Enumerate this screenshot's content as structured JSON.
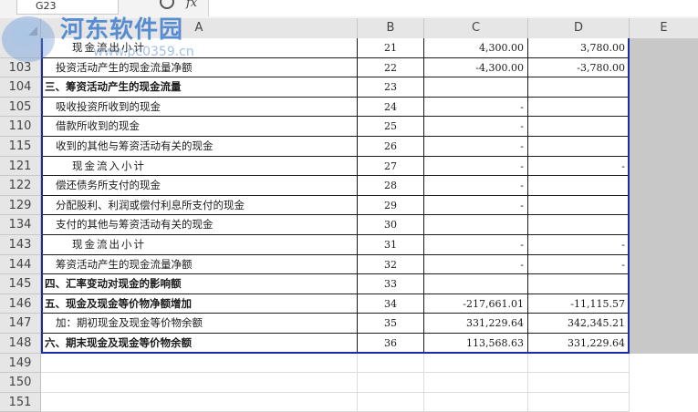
{
  "toolbar": {
    "name_box": "G23",
    "fx_label": "fx"
  },
  "watermark": {
    "title": "河东软件园",
    "url": "www.pc0359.cn"
  },
  "columns": [
    "A",
    "B",
    "C",
    "D",
    "E"
  ],
  "rows": [
    {
      "num": "",
      "a": "现金流出小计",
      "b": "21",
      "c": "4,300.00",
      "d": "3,780.00",
      "style": "ind2"
    },
    {
      "num": "103",
      "a": "投资活动产生的现金流量净额",
      "b": "22",
      "c": "-4,300.00",
      "d": "-3,780.00",
      "style": "ind1"
    },
    {
      "num": "104",
      "a": "三、筹资活动产生的现金流量",
      "b": "23",
      "c": "",
      "d": "",
      "style": "bold"
    },
    {
      "num": "105",
      "a": "吸收投资所收到的现金",
      "b": "24",
      "c": "-",
      "d": "",
      "style": "ind1"
    },
    {
      "num": "110",
      "a": "借款所收到的现金",
      "b": "25",
      "c": "-",
      "d": "",
      "style": "ind1"
    },
    {
      "num": "115",
      "a": "收到的其他与筹资活动有关的现金",
      "b": "26",
      "c": "-",
      "d": "",
      "style": "ind1"
    },
    {
      "num": "121",
      "a": "现金流入小计",
      "b": "27",
      "c": "-",
      "d": "-",
      "style": "ind2"
    },
    {
      "num": "122",
      "a": "偿还债务所支付的现金",
      "b": "28",
      "c": "-",
      "d": "",
      "style": "ind1"
    },
    {
      "num": "129",
      "a": "分配股利、利润或偿付利息所支付的现金",
      "b": "29",
      "c": "-",
      "d": "",
      "style": "ind1"
    },
    {
      "num": "134",
      "a": "支付的其他与筹资活动有关的现金",
      "b": "30",
      "c": "",
      "d": "",
      "style": "ind1"
    },
    {
      "num": "143",
      "a": "现金流出小计",
      "b": "31",
      "c": "-",
      "d": "-",
      "style": "ind2"
    },
    {
      "num": "144",
      "a": "筹资活动产生的现金流量净额",
      "b": "32",
      "c": "-",
      "d": "-",
      "style": "ind1"
    },
    {
      "num": "145",
      "a": "四、汇率变动对现金的影响额",
      "b": "33",
      "c": "",
      "d": "",
      "style": "bold"
    },
    {
      "num": "146",
      "a": "五、现金及现金等价物净额增加",
      "b": "34",
      "c": "-217,661.01",
      "d": "-11,115.57",
      "style": "bold"
    },
    {
      "num": "147",
      "a": "加：期初现金及现金等价物余额",
      "b": "35",
      "c": "331,229.64",
      "d": "342,345.21",
      "style": "ind1"
    },
    {
      "num": "148",
      "a": "六、期末现金及现金等价物余额",
      "b": "36",
      "c": "113,568.63",
      "d": "331,229.64",
      "style": "bold"
    }
  ],
  "empty_rows": [
    "149",
    "150",
    "151"
  ]
}
